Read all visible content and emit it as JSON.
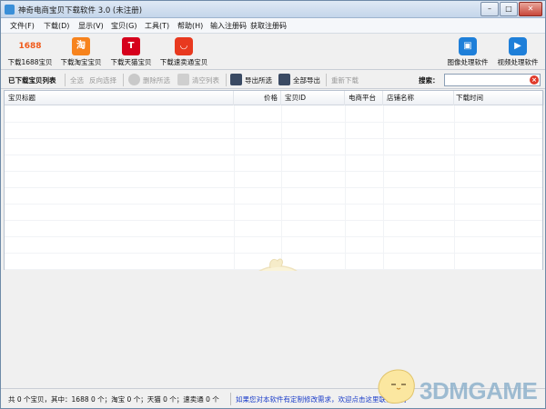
{
  "window": {
    "title": "神奇电商宝贝下载软件 3.0 (未注册)",
    "minimize": "–",
    "maximize": "□",
    "close": "✕"
  },
  "menu": [
    {
      "label": "文件(F)"
    },
    {
      "label": "下载(D)"
    },
    {
      "label": "显示(V)"
    },
    {
      "label": "宝贝(G)"
    },
    {
      "label": "工具(T)"
    },
    {
      "label": "帮助(H)"
    },
    {
      "label": "输入注册码"
    },
    {
      "label": "获取注册码"
    }
  ],
  "toolbar": {
    "download_1688": {
      "label": "下载1688宝贝",
      "icon": "1688"
    },
    "download_taobao": {
      "label": "下载淘宝宝贝",
      "icon": "淘"
    },
    "download_tmall": {
      "label": "下载天猫宝贝",
      "icon": "T"
    },
    "download_aliexpress": {
      "label": "下载速卖通宝贝",
      "icon": "◡"
    },
    "image_software": {
      "label": "图像处理软件",
      "icon": "▣"
    },
    "video_software": {
      "label": "视频处理软件",
      "icon": "▶"
    }
  },
  "toolbar2": {
    "list_title": "已下载宝贝列表",
    "select_all": "全选",
    "invert_select": "反向选择",
    "delete_selected": "删除所选",
    "clear_list": "清空列表",
    "export_selected": "导出所选",
    "export_all": "全部导出",
    "re_download": "重新下载",
    "search_label": "搜索：",
    "search_value": "",
    "search_clear": "×"
  },
  "table": {
    "columns": [
      "宝贝标题",
      "价格",
      "宝贝ID",
      "电商平台",
      "店铺名称",
      "下载时间"
    ],
    "rows": []
  },
  "status": {
    "count_text": "共 0 个宝贝，其中：1688 0 个；淘宝 0 个；天猫 0 个；速卖通 0 个",
    "custom_text": "如果您对本软件有定制修改需求，欢迎点击这里联系我们"
  },
  "watermark": {
    "text": "3DMGAME"
  },
  "colors": {
    "accent": "#1e7fd9",
    "taobao": "#f7831d",
    "tmall": "#d6001c",
    "aliexpress": "#e8391f",
    "link": "#1a3cc9"
  }
}
